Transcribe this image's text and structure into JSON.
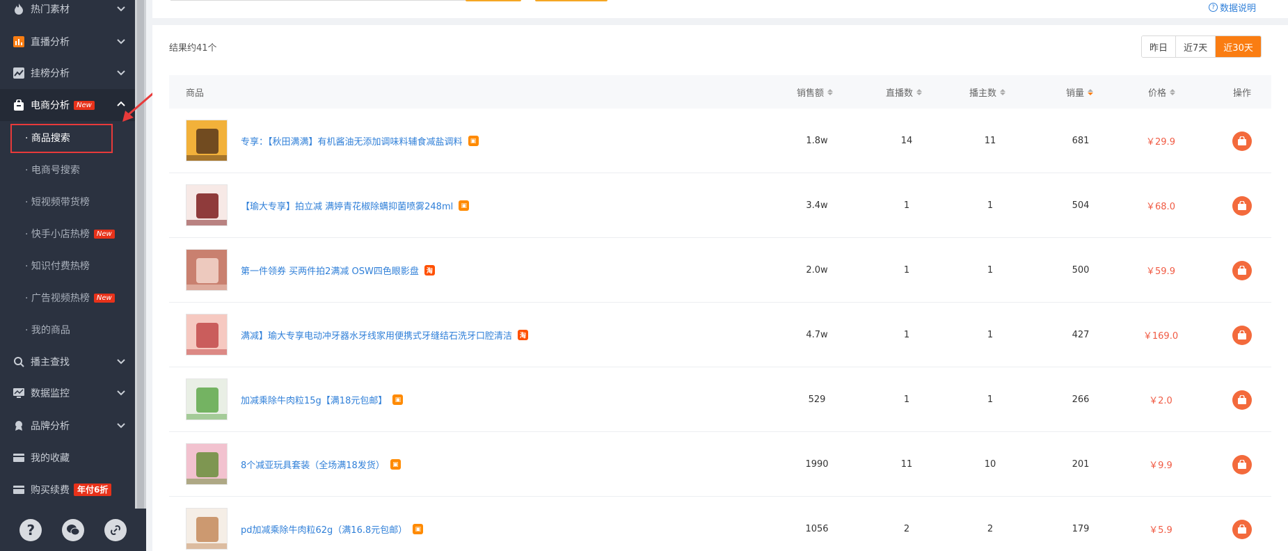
{
  "sidebar": {
    "items": [
      {
        "label": "热门素材",
        "icon": "fire-icon"
      },
      {
        "label": "直播分析",
        "icon": "bar-chart-icon"
      },
      {
        "label": "挂榜分析",
        "icon": "trend-chart-icon"
      },
      {
        "label": "电商分析",
        "icon": "shopping-bag-icon",
        "badge": "New"
      },
      {
        "label": "播主查找",
        "icon": "search-icon"
      },
      {
        "label": "数据监控",
        "icon": "monitor-icon"
      },
      {
        "label": "品牌分析",
        "icon": "brand-icon"
      },
      {
        "label": "我的收藏",
        "icon": "folder-icon"
      },
      {
        "label": "购买续费",
        "icon": "card-icon",
        "badge": "年付6折"
      }
    ],
    "sub_items": [
      {
        "label": "· 商品搜索"
      },
      {
        "label": "· 电商号搜索"
      },
      {
        "label": "· 短视频带货榜"
      },
      {
        "label": "· 快手小店热榜",
        "badge": "New"
      },
      {
        "label": "· 知识付费热榜"
      },
      {
        "label": "· 广告视频热榜",
        "badge": "New"
      },
      {
        "label": "· 我的商品"
      }
    ],
    "bottom": [
      {
        "icon": "help-icon"
      },
      {
        "icon": "wechat-icon"
      },
      {
        "icon": "link-icon"
      }
    ]
  },
  "header": {
    "data_explain": "数据说明"
  },
  "results": {
    "count_text": "结果约41个",
    "ranges": [
      "昨日",
      "近7天",
      "近30天"
    ],
    "active_range": "近30天"
  },
  "table": {
    "columns": [
      "商品",
      "销售额",
      "直播数",
      "播主数",
      "销量",
      "价格",
      "操作"
    ],
    "rows": [
      {
        "name": "专享：【秋田满满】有机酱油无添加调味料辅食减盐调料",
        "shop": "ks",
        "sales_amount": "1.8w",
        "live_count": "14",
        "streamer_count": "11",
        "volume": "681",
        "price": "￥29.9"
      },
      {
        "name": "【瑜大专享】拍立减 满婷青花椒除螨抑菌喷雾248ml",
        "shop": "ks",
        "sales_amount": "3.4w",
        "live_count": "1",
        "streamer_count": "1",
        "volume": "504",
        "price": "￥68.0"
      },
      {
        "name": "第一件领券 买两件拍2满减 OSW四色眼影盘",
        "shop": "tb",
        "sales_amount": "2.0w",
        "live_count": "1",
        "streamer_count": "1",
        "volume": "500",
        "price": "￥59.9"
      },
      {
        "name": "满减】瑜大专享电动冲牙器水牙线家用便携式牙缝结石洗牙口腔清洁",
        "shop": "tb",
        "sales_amount": "4.7w",
        "live_count": "1",
        "streamer_count": "1",
        "volume": "427",
        "price": "￥169.0"
      },
      {
        "name": "加减乘除牛肉粒15g【满18元包邮】",
        "shop": "ks",
        "sales_amount": "529",
        "live_count": "1",
        "streamer_count": "1",
        "volume": "266",
        "price": "￥2.0"
      },
      {
        "name": "8个减亚玩具套装（全场满18发货）",
        "shop": "ks",
        "sales_amount": "1990",
        "live_count": "11",
        "streamer_count": "10",
        "volume": "201",
        "price": "￥9.9"
      },
      {
        "name": "pd加减乘除牛肉粒62g（满16.8元包邮）",
        "shop": "ks",
        "sales_amount": "1056",
        "live_count": "2",
        "streamer_count": "2",
        "volume": "179",
        "price": "￥5.9"
      }
    ]
  },
  "colors": {
    "sidebar_bg": "#2b3240",
    "accent": "#fa7d12",
    "link": "#2f7fd8",
    "price": "#f05a43",
    "badge": "#e8321a"
  }
}
